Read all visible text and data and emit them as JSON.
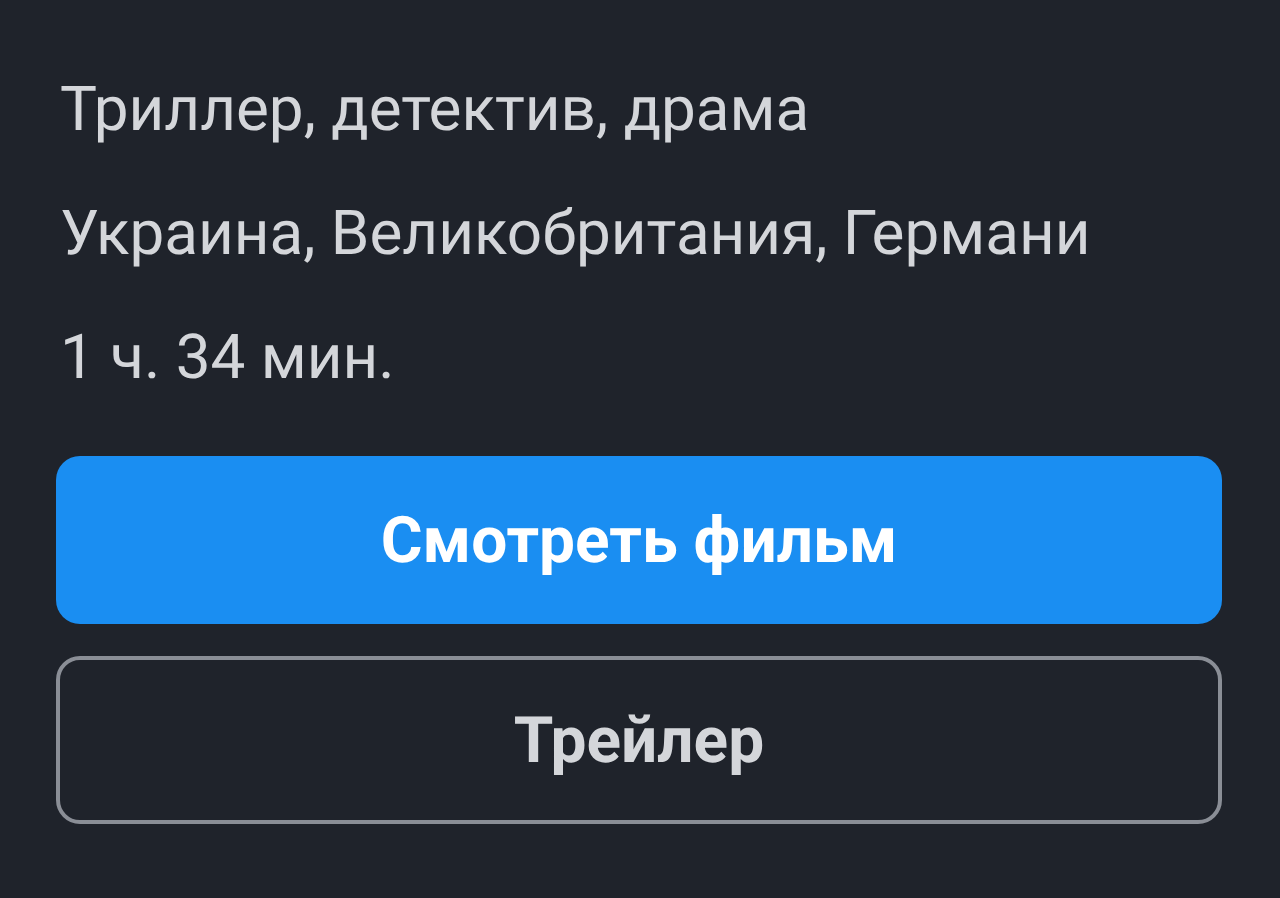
{
  "details": [
    {
      "text": "Триллер, детектив, драма"
    },
    {
      "text": "Украина, Великобритания, Германи"
    },
    {
      "text": "1 ч. 34 мин."
    }
  ],
  "buttons": [
    {
      "kind": "primary",
      "label": "Смотреть фильм"
    },
    {
      "kind": "outline",
      "label": "Трейлер"
    }
  ]
}
